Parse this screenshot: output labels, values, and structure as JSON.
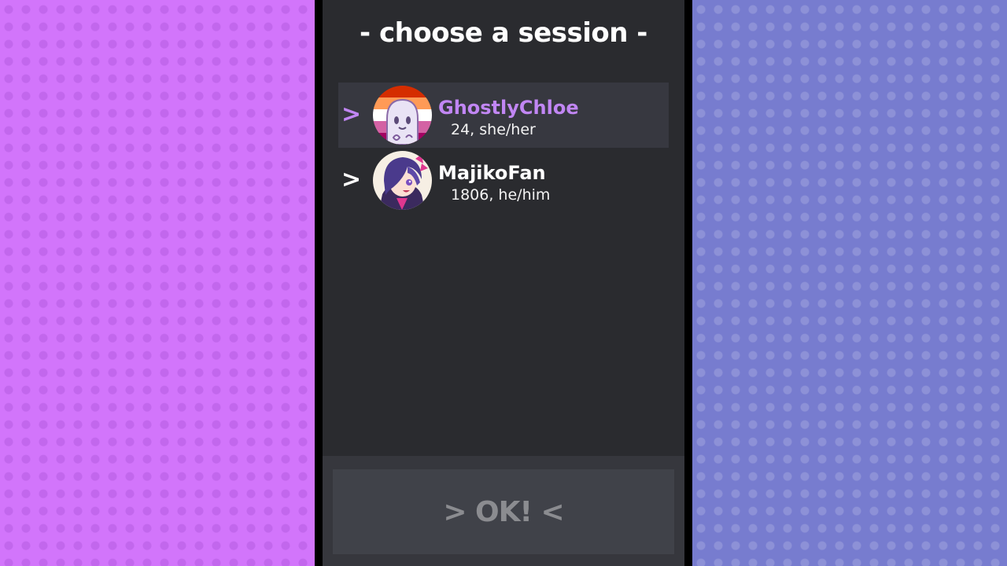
{
  "title": "- choose a session -",
  "sessions": [
    {
      "arrow": ">",
      "name": "GhostlyChloe",
      "details": "24, she/her",
      "avatar_icon": "ghost-avatar",
      "selected": true
    },
    {
      "arrow": ">",
      "name": "MajikoFan",
      "details": "1806, he/him",
      "avatar_icon": "anime-character-avatar",
      "selected": false
    }
  ],
  "ok_button": {
    "label": "> OK! <"
  },
  "colors": {
    "left_background": "#d275fb",
    "right_background": "#777ccf",
    "panel": "#2a2b2f",
    "accent": "#c186f4",
    "selected_row": "#373840",
    "button": "#404249",
    "button_text": "#8b8c90"
  }
}
